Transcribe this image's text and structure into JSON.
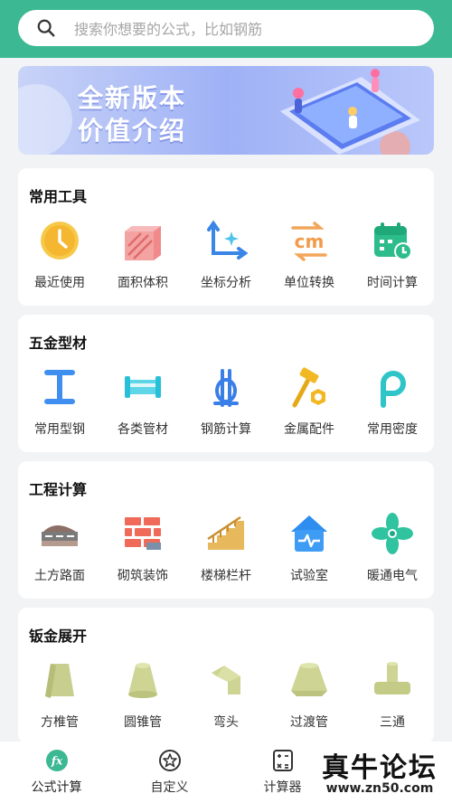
{
  "search": {
    "placeholder": "搜索你想要的公式，比如钢筋"
  },
  "banner": {
    "line1": "全新版本",
    "line2": "价值介绍"
  },
  "sections": [
    {
      "title": "常用工具",
      "items": [
        {
          "label": "最近使用",
          "icon": "clock-icon"
        },
        {
          "label": "面积体积",
          "icon": "cube-icon"
        },
        {
          "label": "坐标分析",
          "icon": "axis-icon"
        },
        {
          "label": "单位转换",
          "icon": "cm-convert-icon"
        },
        {
          "label": "时间计算",
          "icon": "calendar-clock-icon"
        }
      ]
    },
    {
      "title": "五金型材",
      "items": [
        {
          "label": "常用型钢",
          "icon": "i-beam-icon"
        },
        {
          "label": "各类管材",
          "icon": "pipe-icon"
        },
        {
          "label": "钢筋计算",
          "icon": "rebar-icon"
        },
        {
          "label": "金属配件",
          "icon": "hammer-nut-icon"
        },
        {
          "label": "常用密度",
          "icon": "rho-icon"
        }
      ]
    },
    {
      "title": "工程计算",
      "items": [
        {
          "label": "土方路面",
          "icon": "road-icon"
        },
        {
          "label": "砌筑装饰",
          "icon": "brick-wall-icon"
        },
        {
          "label": "楼梯栏杆",
          "icon": "stairs-icon"
        },
        {
          "label": "试验室",
          "icon": "lab-house-icon"
        },
        {
          "label": "暖通电气",
          "icon": "fan-icon"
        }
      ]
    },
    {
      "title": "钣金展开",
      "items": [
        {
          "label": "方椎管",
          "icon": "square-frustum-icon"
        },
        {
          "label": "圆锥管",
          "icon": "cone-frustum-icon"
        },
        {
          "label": "弯头",
          "icon": "elbow-icon"
        },
        {
          "label": "过渡管",
          "icon": "transition-icon"
        },
        {
          "label": "三通",
          "icon": "tee-icon"
        }
      ]
    }
  ],
  "tabs": [
    {
      "label": "公式计算",
      "icon": "fx-icon",
      "active": true
    },
    {
      "label": "自定义",
      "icon": "star-icon"
    },
    {
      "label": "计算器",
      "icon": "calculator-icon"
    }
  ],
  "watermark": {
    "line1": "真牛论坛",
    "line2": "www.zn50.com"
  },
  "colors": {
    "brand": "#3cb892",
    "background": "#f2f3f5"
  }
}
